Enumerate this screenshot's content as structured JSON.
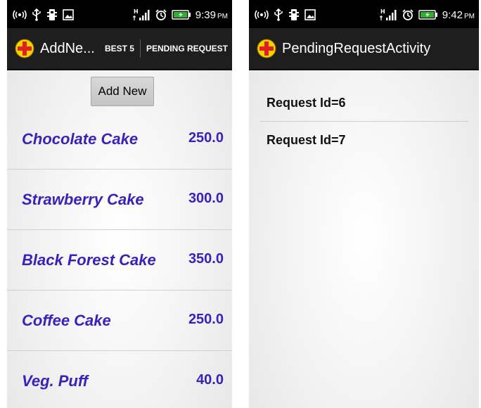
{
  "colors": {
    "item_text": "#3a22b8",
    "action_bar": "#1e1e1e",
    "status_bar": "#000000"
  },
  "left_screen": {
    "status_bar": {
      "time": "9:39",
      "ampm": "PM",
      "icons": [
        "wireless-icon",
        "usb-icon",
        "debug-icon",
        "image-icon",
        "network-h-icon",
        "signal-icon",
        "alarm-icon",
        "battery-charging-icon"
      ]
    },
    "action_bar": {
      "title": "AddNe...",
      "action_best5": "BEST 5",
      "action_pending": "PENDING REQUEST"
    },
    "add_new_label": "Add New",
    "products": [
      {
        "name": "Chocolate Cake",
        "price": "250.0"
      },
      {
        "name": "Strawberry Cake",
        "price": "300.0"
      },
      {
        "name": "Black Forest Cake",
        "price": "350.0"
      },
      {
        "name": "Coffee Cake",
        "price": "250.0"
      },
      {
        "name": "Veg. Puff",
        "price": "40.0"
      }
    ]
  },
  "right_screen": {
    "status_bar": {
      "time": "9:42",
      "ampm": "PM",
      "icons": [
        "wireless-icon",
        "usb-icon",
        "debug-icon",
        "image-icon",
        "network-h-icon",
        "signal-icon",
        "alarm-icon",
        "battery-charging-icon"
      ]
    },
    "action_bar": {
      "title": "PendingRequestActivity"
    },
    "requests": [
      {
        "label": "Request Id=6"
      },
      {
        "label": "Request Id=7"
      }
    ]
  }
}
